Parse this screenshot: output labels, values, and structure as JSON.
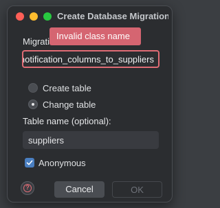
{
  "window": {
    "title": "Create Database Migration"
  },
  "migration_name": {
    "label": "Migration name:",
    "value": "add_notification_columns_to_suppliers",
    "error_tooltip": "Invalid class name"
  },
  "mode": {
    "options": [
      {
        "label": "Create table",
        "checked": false
      },
      {
        "label": "Change table",
        "checked": true
      }
    ]
  },
  "table_name": {
    "label": "Table name (optional):",
    "value": "suppliers"
  },
  "anonymous": {
    "label": "Anonymous",
    "checked": true
  },
  "buttons": {
    "help": "?",
    "cancel": "Cancel",
    "ok": "OK"
  },
  "colors": {
    "error": "#e06c75",
    "tooltip_bg": "#d56571",
    "checkbox_accent": "#4a7fc1"
  }
}
